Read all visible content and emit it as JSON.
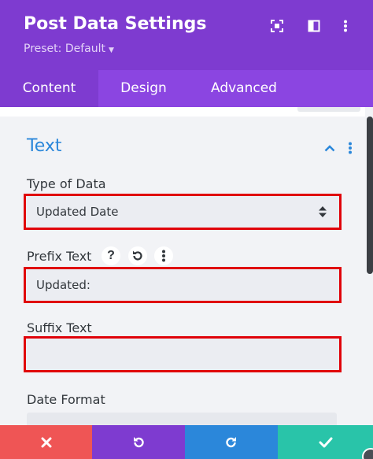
{
  "header": {
    "title": "Post Data Settings",
    "preset_label": "Preset: Default",
    "icons": [
      "focus-icon",
      "sidebar-icon",
      "more-vertical-icon"
    ]
  },
  "tabs": [
    {
      "label": "Content",
      "active": true
    },
    {
      "label": "Design",
      "active": false
    },
    {
      "label": "Advanced",
      "active": false
    }
  ],
  "section": {
    "title": "Text"
  },
  "fields": {
    "type_of_data": {
      "label": "Type of Data",
      "value": "Updated Date"
    },
    "prefix_text": {
      "label": "Prefix Text",
      "value": "Updated:",
      "help_symbol": "?"
    },
    "suffix_text": {
      "label": "Suffix Text",
      "value": ""
    },
    "date_format": {
      "label": "Date Format"
    }
  },
  "footer": {
    "buttons": [
      "cancel",
      "undo",
      "redo",
      "save"
    ],
    "colors": {
      "cancel": "#ef5555",
      "undo": "#7e3bd0",
      "redo": "#2b87da",
      "save": "#29c4a9"
    }
  },
  "colors": {
    "header": "#7e3bd0",
    "tabs": "#8b45e1",
    "section_title": "#2b87da",
    "highlight": "#e0030a"
  }
}
